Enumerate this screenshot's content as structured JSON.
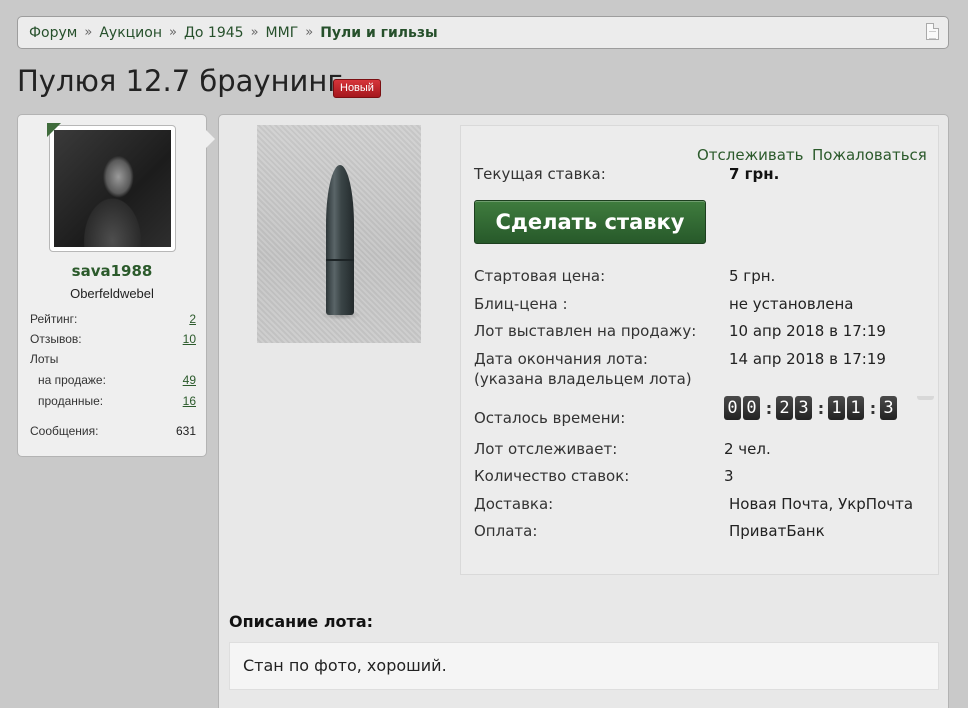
{
  "breadcrumb": [
    "Форум",
    "Аукцион",
    "До 1945",
    "ММГ",
    "Пули и гильзы"
  ],
  "separator": "»",
  "title": "Пулюя 12.7 браунинг",
  "badge": "Новый",
  "user": {
    "name": "sava1988",
    "rank": "Oberfeldwebel",
    "stats": {
      "rating_label": "Рейтинг:",
      "rating": "2",
      "reviews_label": "Отзывов:",
      "reviews": "10",
      "lots_label": "Лоты",
      "on_sale_label": "на продаже:",
      "on_sale": "49",
      "sold_label": "проданные:",
      "sold": "16",
      "messages_label": "Сообщения:",
      "messages": "631"
    }
  },
  "lot": {
    "watch_link": "Отслеживать",
    "report_link": "Пожаловаться",
    "current_bid_label": "Текущая ставка:",
    "current_bid": "7 грн.",
    "bid_button": "Сделать ставку",
    "start_price_label": "Стартовая цена:",
    "start_price": "5 грн.",
    "blitz_label": "Блиц-цена :",
    "blitz": "не установлена",
    "listed_label": "Лот выставлен на продажу:",
    "listed": "10 апр 2018 в 17:19",
    "end_label": "Дата окончания лота:",
    "end_note": "(указана владельцем лота)",
    "end": "14 апр 2018 в 17:19",
    "remaining_label": "Осталось времени:",
    "timer": {
      "d1": "0",
      "d2": "0",
      "h1": "2",
      "h2": "3",
      "m1": "1",
      "m2": "1",
      "s1": "3"
    },
    "watchers_label": "Лот отслеживает:",
    "watchers": "2 чел.",
    "bids_label": "Количество ставок:",
    "bids": "3",
    "delivery_label": "Доставка:",
    "delivery": "Новая Почта, УкрПочта",
    "payment_label": "Оплата:",
    "payment": "ПриватБанк"
  },
  "description": {
    "title": "Описание лота:",
    "text": "Стан по фото, хороший."
  }
}
